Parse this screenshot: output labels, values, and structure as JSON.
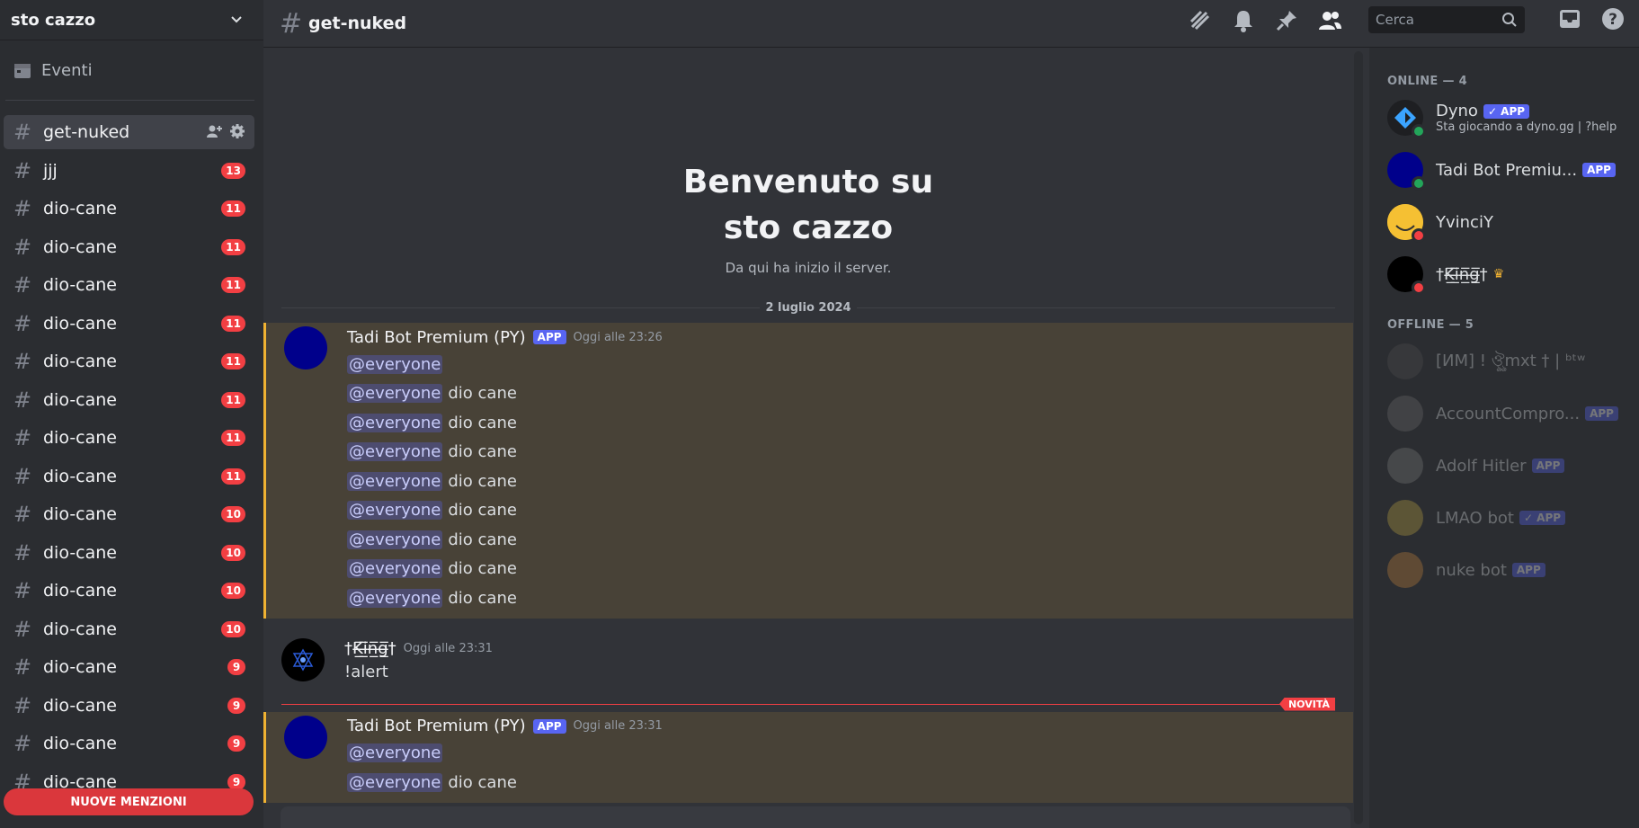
{
  "server": {
    "name": "sto cazzo"
  },
  "sidebar": {
    "events_label": "Eventi",
    "channels": [
      {
        "name": "get-nuked",
        "badge": "",
        "active": true
      },
      {
        "name": "jjj",
        "badge": "13"
      },
      {
        "name": "dio-cane",
        "badge": "11"
      },
      {
        "name": "dio-cane",
        "badge": "11"
      },
      {
        "name": "dio-cane",
        "badge": "11"
      },
      {
        "name": "dio-cane",
        "badge": "11"
      },
      {
        "name": "dio-cane",
        "badge": "11"
      },
      {
        "name": "dio-cane",
        "badge": "11"
      },
      {
        "name": "dio-cane",
        "badge": "11"
      },
      {
        "name": "dio-cane",
        "badge": "11"
      },
      {
        "name": "dio-cane",
        "badge": "10"
      },
      {
        "name": "dio-cane",
        "badge": "10"
      },
      {
        "name": "dio-cane",
        "badge": "10"
      },
      {
        "name": "dio-cane",
        "badge": "10"
      },
      {
        "name": "dio-cane",
        "badge": "9"
      },
      {
        "name": "dio-cane",
        "badge": "9"
      },
      {
        "name": "dio-cane",
        "badge": "9"
      },
      {
        "name": "dio-cane",
        "badge": "9"
      }
    ],
    "new_mentions_label": "NUOVE MENZIONI"
  },
  "topbar": {
    "channel_name": "get-nuked",
    "search_placeholder": "Cerca"
  },
  "chat": {
    "welcome_line1": "Benvenuto su",
    "welcome_line2": "sto cazzo",
    "welcome_sub": "Da qui ha inizio il server.",
    "date_divider": "2 luglio 2024",
    "new_label": "NOVITÀ",
    "messages": [
      {
        "author": "Tadi Bot Premium (PY)",
        "app_tag": "APP",
        "timestamp": "Oggi alle 23:26",
        "lines": [
          {
            "mention": "@everyone",
            "text": ""
          },
          {
            "mention": "@everyone",
            "text": "dio cane"
          },
          {
            "mention": "@everyone",
            "text": "dio cane"
          },
          {
            "mention": "@everyone",
            "text": "dio cane"
          },
          {
            "mention": "@everyone",
            "text": "dio cane"
          },
          {
            "mention": "@everyone",
            "text": "dio cane"
          },
          {
            "mention": "@everyone",
            "text": "dio cane"
          },
          {
            "mention": "@everyone",
            "text": "dio cane"
          },
          {
            "mention": "@everyone",
            "text": "dio cane"
          }
        ]
      },
      {
        "author": "†K̶̲̅i̶̲̅n̶̲̅g̶̲̅†",
        "timestamp": "Oggi alle 23:31",
        "text": "!alert"
      },
      {
        "author": "Tadi Bot Premium (PY)",
        "app_tag": "APP",
        "timestamp": "Oggi alle 23:31",
        "lines": [
          {
            "mention": "@everyone",
            "text": ""
          },
          {
            "mention": "@everyone",
            "text": "dio cane"
          }
        ]
      }
    ]
  },
  "members": {
    "online_header": "ONLINE — 4",
    "offline_header": "OFFLINE — 5",
    "online": [
      {
        "name": "Dyno",
        "tag": "✓ APP",
        "sub": "Sta giocando a dyno.gg | ?help",
        "status": "online"
      },
      {
        "name": "Tadi Bot Premiu...",
        "tag": "APP",
        "status": "online"
      },
      {
        "name": "YvinciY",
        "status": "dnd"
      },
      {
        "name": "†K̶̲̅i̶̲̅n̶̲̅g̶̲̅†",
        "crown": "♛",
        "status": "dnd"
      }
    ],
    "offline": [
      {
        "name": "[ИМ] ! ঔৣmxt † | ᵇᵗʷ",
        "tag": ""
      },
      {
        "name": "AccountCompro...",
        "tag": "APP"
      },
      {
        "name": "Adolf Hitler",
        "tag": "APP"
      },
      {
        "name": "LMAO bot",
        "tag": "✓ APP"
      },
      {
        "name": "nuke bot",
        "tag": "APP"
      }
    ]
  }
}
